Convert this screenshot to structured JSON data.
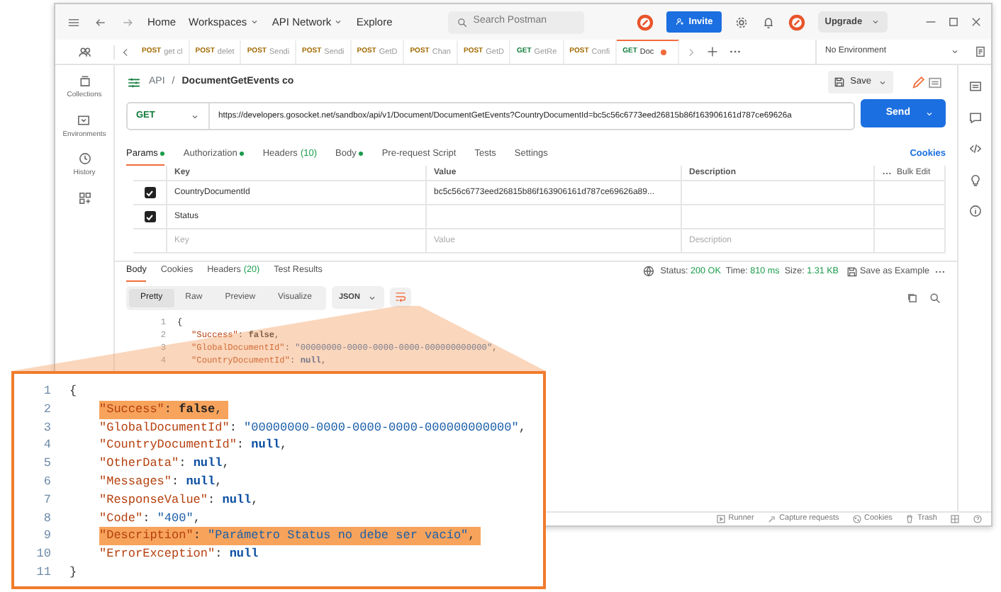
{
  "title_bar": {
    "menu_items": [
      {
        "label": "Home",
        "dropdown": false
      },
      {
        "label": "Workspaces",
        "dropdown": true
      },
      {
        "label": "API Network",
        "dropdown": true
      },
      {
        "label": "Explore",
        "dropdown": false
      }
    ],
    "search": {
      "placeholder": "Search Postman"
    },
    "invite": "Invite",
    "upgrade": "Upgrade"
  },
  "tabs": [
    {
      "method": "POST",
      "label": "get cl",
      "selected": false,
      "unsaved": false
    },
    {
      "method": "POST",
      "label": "delet",
      "selected": false,
      "unsaved": false
    },
    {
      "method": "POST",
      "label": "Sendi",
      "selected": false,
      "unsaved": false
    },
    {
      "method": "POST",
      "label": "Sendi",
      "selected": false,
      "unsaved": false
    },
    {
      "method": "POST",
      "label": "GetD",
      "selected": false,
      "unsaved": false
    },
    {
      "method": "POST",
      "label": "Chan",
      "selected": false,
      "unsaved": false
    },
    {
      "method": "POST",
      "label": "GetD",
      "selected": false,
      "unsaved": false
    },
    {
      "method": "GET",
      "label": "GetRe",
      "selected": false,
      "unsaved": false
    },
    {
      "method": "POST",
      "label": "Confi",
      "selected": false,
      "unsaved": false
    },
    {
      "method": "GET",
      "label": "Doc",
      "selected": true,
      "unsaved": true
    }
  ],
  "environment": "No Environment",
  "sidebar": {
    "items": [
      {
        "kind": "collections",
        "label": "Collections"
      },
      {
        "kind": "environments",
        "label": "Environments"
      },
      {
        "kind": "history",
        "label": "History"
      }
    ]
  },
  "request": {
    "breadcrumb": "API",
    "breadcrumb_separator": "/",
    "name": "DocumentGetEvents co",
    "save": "Save",
    "method": "GET",
    "url": "https://developers.gosocket.net/sandbox/api/v1/Document/DocumentGetEvents?CountryDocumentId=bc5c56c6773eed26815b86f163906161d787ce69626a",
    "send": "Send",
    "tabs": [
      {
        "label": "Params",
        "dot": true,
        "selected": true
      },
      {
        "label": "Authorization",
        "dot": true,
        "selected": false
      },
      {
        "label": "Headers",
        "count": "(10)",
        "dot": false,
        "selected": false
      },
      {
        "label": "Body",
        "dot": true,
        "selected": false
      },
      {
        "label": "Pre-request Script",
        "dot": false,
        "selected": false
      },
      {
        "label": "Tests",
        "dot": false,
        "selected": false
      },
      {
        "label": "Settings",
        "dot": false,
        "selected": false
      }
    ],
    "cookies": "Cookies",
    "params": {
      "columns": [
        "Key",
        "Value",
        "Description"
      ],
      "bulk_edit": "Bulk Edit",
      "rows": [
        {
          "checked": true,
          "key": "CountryDocumentId",
          "value": "bc5c56c6773eed26815b86f163906161d787ce69626a89..."
        },
        {
          "checked": true,
          "key": "Status"
        }
      ],
      "new_row": {
        "key": "Key",
        "value": "Value",
        "description": "Description"
      }
    }
  },
  "response": {
    "tabs": [
      {
        "label": "Body",
        "selected": true
      },
      {
        "label": "Cookies",
        "selected": false
      },
      {
        "label": "Headers",
        "count": "(20)",
        "selected": false
      },
      {
        "label": "Test Results",
        "selected": false
      }
    ],
    "status_label": "Status:",
    "status": "200 OK",
    "time_label": "Time:",
    "time": "810 ms",
    "size_label": "Size:",
    "size": "1.31 KB",
    "save_example": "Save as Example",
    "views": [
      {
        "label": "Pretty",
        "selected": true
      },
      {
        "label": "Raw",
        "selected": false
      },
      {
        "label": "Preview",
        "selected": false
      },
      {
        "label": "Visualize",
        "selected": false
      }
    ],
    "format": "JSON",
    "lines": [
      {
        "number": "1",
        "tokens": [
          {
            "kind": "punct",
            "text": "{"
          }
        ]
      },
      {
        "number": "2",
        "tokens": [
          {
            "kind": "key",
            "text": "\"Success\""
          },
          {
            "kind": "punct",
            "text": ": "
          },
          {
            "kind": "bool",
            "text": "false"
          },
          {
            "kind": "punct",
            "text": ","
          }
        ]
      },
      {
        "number": "3",
        "tokens": [
          {
            "kind": "key",
            "text": "\"GlobalDocumentId\""
          },
          {
            "kind": "punct",
            "text": ": "
          },
          {
            "kind": "string",
            "text": "\"00000000-0000-0000-0000-000000000000\""
          },
          {
            "kind": "punct",
            "text": ","
          }
        ]
      },
      {
        "number": "4",
        "tokens": [
          {
            "kind": "key",
            "text": "\"CountryDocumentId\""
          },
          {
            "kind": "punct",
            "text": ": "
          },
          {
            "kind": "null",
            "text": "null"
          },
          {
            "kind": "punct",
            "text": ","
          }
        ]
      }
    ]
  },
  "status_bar": [
    {
      "kind": "runner",
      "label": "Runner"
    },
    {
      "kind": "capture",
      "label": "Capture requests"
    },
    {
      "kind": "cookies",
      "label": "Cookies"
    },
    {
      "kind": "trash",
      "label": "Trash"
    }
  ],
  "callout": {
    "lines": [
      {
        "number": "1",
        "highlighted": false,
        "tokens": [
          {
            "kind": "punct",
            "text": "{"
          }
        ]
      },
      {
        "number": "2",
        "highlighted": true,
        "tokens": [
          {
            "kind": "key",
            "text": "\"Success\""
          },
          {
            "kind": "punct",
            "text": ": "
          },
          {
            "kind": "bool",
            "text": "false"
          },
          {
            "kind": "punct",
            "text": ","
          }
        ]
      },
      {
        "number": "3",
        "highlighted": false,
        "tokens": [
          {
            "kind": "key",
            "text": "\"GlobalDocumentId\""
          },
          {
            "kind": "punct",
            "text": ": "
          },
          {
            "kind": "string",
            "text": "\"00000000-0000-0000-0000-000000000000\""
          },
          {
            "kind": "punct",
            "text": ","
          }
        ]
      },
      {
        "number": "4",
        "highlighted": false,
        "tokens": [
          {
            "kind": "key",
            "text": "\"CountryDocumentId\""
          },
          {
            "kind": "punct",
            "text": ": "
          },
          {
            "kind": "null",
            "text": "null"
          },
          {
            "kind": "punct",
            "text": ","
          }
        ]
      },
      {
        "number": "5",
        "highlighted": false,
        "tokens": [
          {
            "kind": "key",
            "text": "\"OtherData\""
          },
          {
            "kind": "punct",
            "text": ": "
          },
          {
            "kind": "null",
            "text": "null"
          },
          {
            "kind": "punct",
            "text": ","
          }
        ]
      },
      {
        "number": "6",
        "highlighted": false,
        "tokens": [
          {
            "kind": "key",
            "text": "\"Messages\""
          },
          {
            "kind": "punct",
            "text": ": "
          },
          {
            "kind": "null",
            "text": "null"
          },
          {
            "kind": "punct",
            "text": ","
          }
        ]
      },
      {
        "number": "7",
        "highlighted": false,
        "tokens": [
          {
            "kind": "key",
            "text": "\"ResponseValue\""
          },
          {
            "kind": "punct",
            "text": ": "
          },
          {
            "kind": "null",
            "text": "null"
          },
          {
            "kind": "punct",
            "text": ","
          }
        ]
      },
      {
        "number": "8",
        "highlighted": false,
        "tokens": [
          {
            "kind": "key",
            "text": "\"Code\""
          },
          {
            "kind": "punct",
            "text": ": "
          },
          {
            "kind": "string",
            "text": "\"400\""
          },
          {
            "kind": "punct",
            "text": ","
          }
        ]
      },
      {
        "number": "9",
        "highlighted": true,
        "tokens": [
          {
            "kind": "key",
            "text": "\"Description\""
          },
          {
            "kind": "punct",
            "text": ": "
          },
          {
            "kind": "string",
            "text": "\"Parámetro Status no debe ser vacío\""
          },
          {
            "kind": "punct",
            "text": ","
          }
        ]
      },
      {
        "number": "10",
        "highlighted": false,
        "tokens": [
          {
            "kind": "key",
            "text": "\"ErrorException\""
          },
          {
            "kind": "punct",
            "text": ": "
          },
          {
            "kind": "null",
            "text": "null"
          }
        ]
      },
      {
        "number": "11",
        "highlighted": false,
        "tokens": [
          {
            "kind": "punct",
            "text": "}"
          }
        ]
      }
    ]
  }
}
